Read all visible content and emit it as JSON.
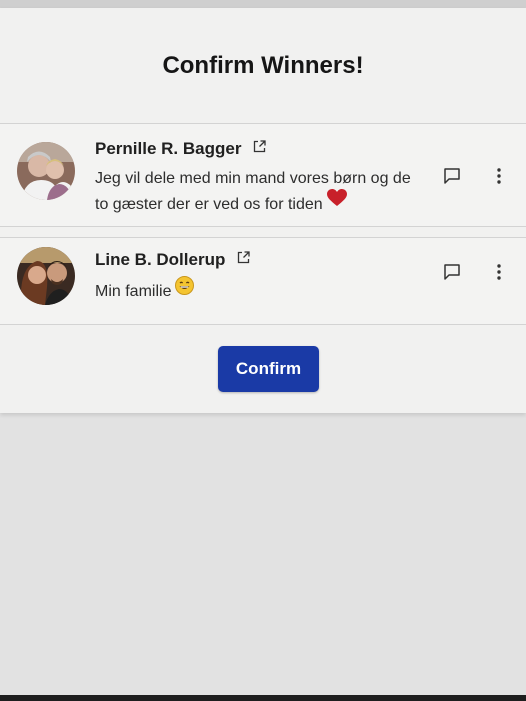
{
  "modal": {
    "title": "Confirm Winners!"
  },
  "winners": [
    {
      "name": "Pernille R. Bagger",
      "message": "Jeg vil dele med min mand vores børn og de to gæster der er ved os for tiden",
      "emoji": "red-heart"
    },
    {
      "name": "Line B. Dollerup",
      "message": "Min familie",
      "emoji": "grinning-face"
    }
  ],
  "actions": {
    "confirm_label": "Confirm"
  },
  "icons": {
    "external_link": "external-link-icon",
    "comment": "comment-icon",
    "more": "more-vertical-icon"
  },
  "colors": {
    "confirm_button": "#1a3aa6",
    "heart": "#c8202a"
  }
}
